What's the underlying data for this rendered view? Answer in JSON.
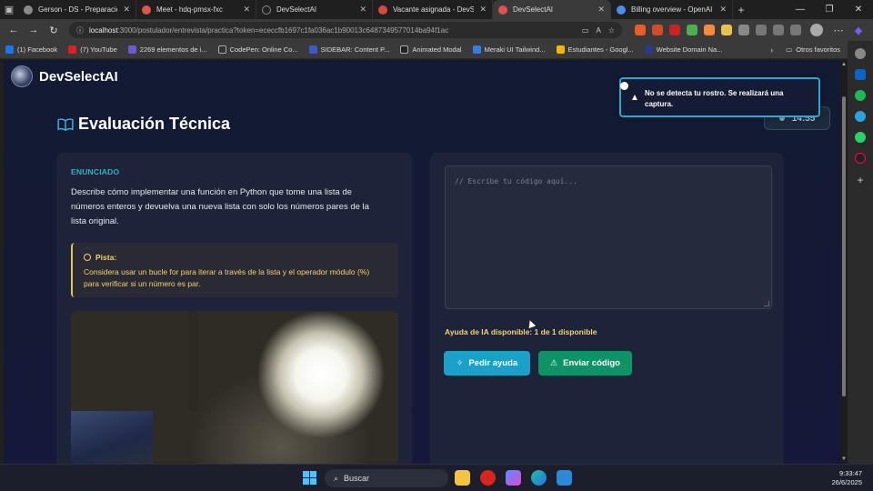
{
  "browser": {
    "tabs": [
      {
        "label": "Gerson - DS - Preparación p",
        "color": "#8a8a8a",
        "active": false
      },
      {
        "label": "Meet - hdq-pmsx-fxc",
        "color": "#e0524a",
        "active": false
      },
      {
        "label": "DevSelectAI",
        "color": "#222222",
        "active": false
      },
      {
        "label": "Vacante asignada - DevS",
        "color": "#d84a3a",
        "active": false
      },
      {
        "label": "DevSelectAI",
        "color": "#e0524a",
        "active": true
      },
      {
        "label": "Billing overview - OpenAI Ac",
        "color": "#4a8cf0",
        "active": false
      }
    ],
    "url_host": "localhost",
    "url_rest": ":3000/postulador/entrevista/practica?token=ececcfb1697c1fa036ac1b90013c6487349577014ba94f1ac",
    "bookmarks": [
      {
        "label": "(1) Facebook",
        "color": "#1877f2"
      },
      {
        "label": "(7) YouTube",
        "color": "#e02020"
      },
      {
        "label": "2269 elementos de i...",
        "color": "#6a5acd"
      },
      {
        "label": "CodePen: Online Co...",
        "color": "#333333"
      },
      {
        "label": "SIDEBAR: Content P...",
        "color": "#3a5ac8"
      },
      {
        "label": "Animated Modal",
        "color": "#222222"
      },
      {
        "label": "Meraki UI Tailwind...",
        "color": "#3a7ae8"
      },
      {
        "label": "Estudiantes - Googl...",
        "color": "#f4b400"
      },
      {
        "label": "Website Domain Na...",
        "color": "#2a3b8f"
      }
    ],
    "bookmarks_folder": "Otros favoritos"
  },
  "app": {
    "brand": "DevSelectAI",
    "page_title": "Evaluación Técnica",
    "timer": "14:55",
    "statement_label": "ENUNCIADO",
    "statement_text": "Describe cómo implementar una función en Python que tome una lista de números enteros y devuelva una nueva lista con solo los números pares de la lista original.",
    "hint_title": "Pista:",
    "hint_text": "Considera usar un bucle for para iterar a través de la lista y el operador módulo (%) para verificar si un número es par.",
    "code_placeholder": "// Escribe tu código aquí...",
    "ai_help_status": "Ayuda de IA disponible: 1 de 1 disponible",
    "help_button": "Pedir ayuda",
    "send_button": "Enviar código",
    "toast_message": "No se detecta tu rostro. Se realizará una captura."
  },
  "taskbar": {
    "search_label": "Buscar",
    "time": "9:33:47",
    "date": "26/6/2025"
  },
  "colors": {
    "accent_cyan": "#22b6c9",
    "hint_yellow": "#f3d36d",
    "help_button": "#1aa0c9",
    "send_button": "#0f9366",
    "page_bg": "#131a33"
  }
}
